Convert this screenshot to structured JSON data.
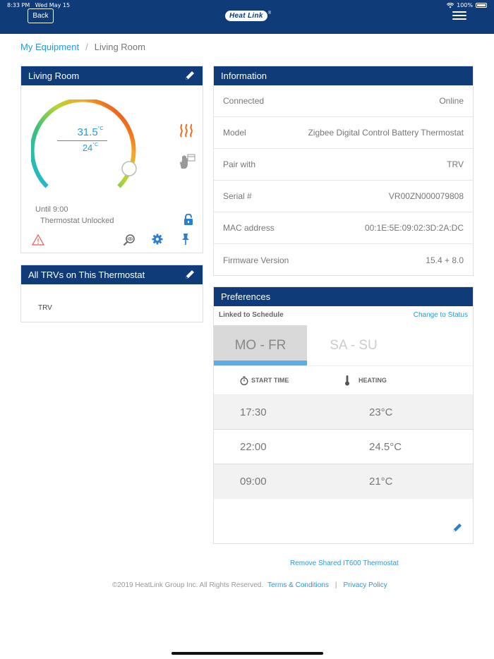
{
  "status_bar": {
    "time": "8:33 PM",
    "date": "Wed May 15",
    "battery": "100%"
  },
  "header": {
    "back_label": "Back",
    "logo_text": "Heat Link"
  },
  "breadcrumb": {
    "parent": "My Equipment",
    "separator": "/",
    "current": "Living Room"
  },
  "thermostat": {
    "title": "Living Room",
    "current_temp": "31.5",
    "set_temp": "24",
    "unit": "°C",
    "until": "Until 9:00",
    "lock_status": "Thermostat Unlocked",
    "dial_level": 0.72
  },
  "trvs": {
    "title": "All TRVs on This Thermostat",
    "items": [
      "TRV"
    ]
  },
  "information": {
    "title": "Information",
    "rows": [
      {
        "label": "Connected",
        "value": "Online"
      },
      {
        "label": "Model",
        "value": "Zigbee Digital Control Battery Thermostat"
      },
      {
        "label": "Pair with",
        "value": "TRV"
      },
      {
        "label": "Serial #",
        "value": "VR00ZN000079808"
      },
      {
        "label": "MAC address",
        "value": "00:1E:5E:09:02:3D:2A:DC"
      },
      {
        "label": "Firmware Version",
        "value": "15.4 + 8.0"
      }
    ]
  },
  "preferences": {
    "title": "Preferences",
    "linked": "Linked to Schedule",
    "change": "Change to Status",
    "days": [
      "MO - FR",
      "SA - SU"
    ],
    "col_start": "START TIME",
    "col_heating": "HEATING",
    "schedule": [
      {
        "time": "17:30",
        "heat": "23°C"
      },
      {
        "time": "22:00",
        "heat": "24.5°C"
      },
      {
        "time": "09:00",
        "heat": "21°C"
      }
    ]
  },
  "remove_link": "Remove Shared IT600 Thermostat",
  "footer": {
    "copyright": "©2019  HeatLink Group Inc. All Rights Reserved.",
    "terms": "Terms & Conditions",
    "divider": "|",
    "privacy": "Privacy Policy"
  },
  "colors": {
    "brand": "#0f3b78",
    "accent": "#2a9ad6"
  }
}
